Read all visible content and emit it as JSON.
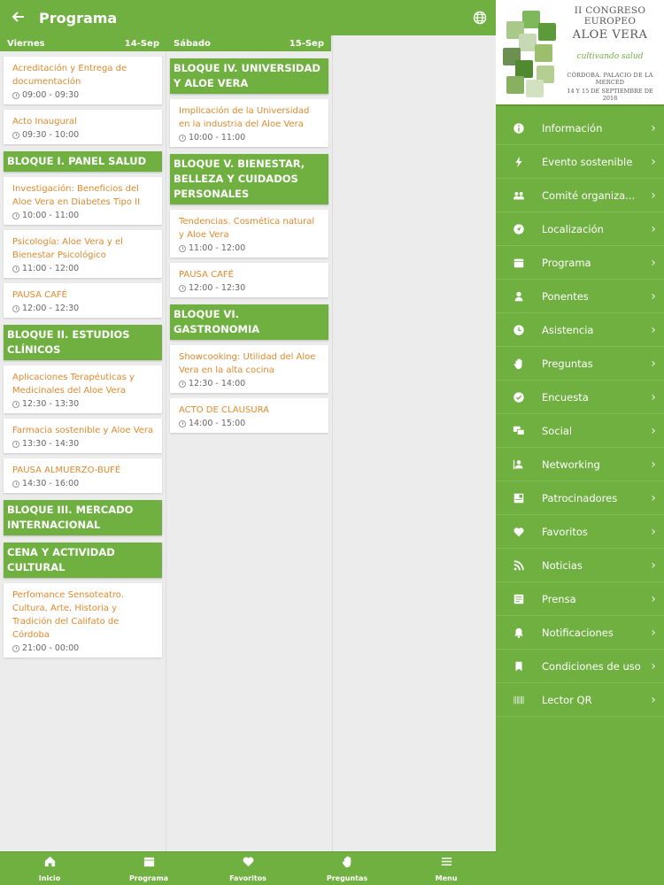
{
  "appbar": {
    "title": "Programa",
    "back_icon": "arrow-left-icon",
    "globe_icon": "globe-icon"
  },
  "days": [
    {
      "name": "Viernes",
      "date": "14-Sep",
      "items": [
        {
          "kind": "session",
          "title": "Acreditación y Entrega de documentación",
          "time": "09:00 - 09:30"
        },
        {
          "kind": "session",
          "title": "Acto Inaugural",
          "time": "09:30 - 10:00"
        },
        {
          "kind": "block",
          "title": "BLOQUE I. PANEL SALUD"
        },
        {
          "kind": "session",
          "title": "Investigación: Beneficios del Aloe Vera en Diabetes Tipo II",
          "time": "10:00 - 11:00"
        },
        {
          "kind": "session",
          "title": "Psicología: Aloe Vera y el Bienestar Psicológico",
          "time": "11:00 - 12:00"
        },
        {
          "kind": "session",
          "title": "PAUSA CAFÉ",
          "time": "12:00 - 12:30"
        },
        {
          "kind": "block",
          "title": "BLOQUE II. ESTUDIOS CLÍNICOS"
        },
        {
          "kind": "session",
          "title": "Aplicaciones Terapéuticas y Medicinales del Aloe Vera",
          "time": "12:30 - 13:30"
        },
        {
          "kind": "session",
          "title": "Farmacia sostenible y Aloe Vera",
          "time": "13:30 - 14:30"
        },
        {
          "kind": "session",
          "title": "PAUSA ALMUERZO-BUFÉ",
          "time": "14:30 - 16:00"
        },
        {
          "kind": "block",
          "title": "BLOQUE III. MERCADO INTERNACIONAL"
        },
        {
          "kind": "block",
          "title": "CENA Y ACTIVIDAD CULTURAL"
        },
        {
          "kind": "session",
          "title": "Perfomance Sensoteatro. Cultura, Arte, Historia y Tradición del Califato de Córdoba",
          "time": "21:00 - 00:00"
        }
      ]
    },
    {
      "name": "Sábado",
      "date": "15-Sep",
      "items": [
        {
          "kind": "block",
          "title": "BLOQUE IV. UNIVERSIDAD Y ALOE VERA"
        },
        {
          "kind": "session",
          "title": "Implicación de la Universidad en la industria del Aloe Vera",
          "time": "10:00 - 11:00"
        },
        {
          "kind": "block",
          "title": "BLOQUE V. BIENESTAR, BELLEZA Y CUIDADOS PERSONALES"
        },
        {
          "kind": "session",
          "title": "Tendencias. Cosmética natural y Aloe Vera",
          "time": "11:00 - 12:00"
        },
        {
          "kind": "session",
          "title": "PAUSA CAFÉ",
          "time": "12:00 - 12:30"
        },
        {
          "kind": "block",
          "title": "BLOQUE VI. GASTRONOMIA"
        },
        {
          "kind": "session",
          "title": "Showcooking: Utilidad del Aloe Vera en la alta cocina",
          "time": "12:30 - 14:00"
        },
        {
          "kind": "session",
          "title": "ACTO DE CLAUSURA",
          "time": "14:00 - 15:00"
        }
      ]
    }
  ],
  "banner": {
    "line1": "II CONGRESO EUROPEO",
    "line2": "ALOE VERA",
    "tagline": "cultivando salud",
    "place": "CÓRDOBA. PALACIO DE LA MERCED",
    "dates": "14 Y 15 DE SEPTIEMBRE DE 2018"
  },
  "menu": [
    {
      "label": "Información",
      "icon": "info-icon"
    },
    {
      "label": "Evento sostenible",
      "icon": "bolt-icon"
    },
    {
      "label": "Comité organiza...",
      "icon": "group-icon"
    },
    {
      "label": "Localización",
      "icon": "location-icon"
    },
    {
      "label": "Programa",
      "icon": "calendar-icon"
    },
    {
      "label": "Ponentes",
      "icon": "person-icon"
    },
    {
      "label": "Asistencia",
      "icon": "clock-icon"
    },
    {
      "label": "Preguntas",
      "icon": "hand-icon"
    },
    {
      "label": "Encuesta",
      "icon": "check-circle-icon"
    },
    {
      "label": "Social",
      "icon": "chat-icon"
    },
    {
      "label": "Networking",
      "icon": "contact-icon"
    },
    {
      "label": "Patrocinadores",
      "icon": "sponsors-icon"
    },
    {
      "label": "Favoritos",
      "icon": "heart-icon"
    },
    {
      "label": "Noticias",
      "icon": "rss-icon"
    },
    {
      "label": "Prensa",
      "icon": "newspaper-icon"
    },
    {
      "label": "Notificaciones",
      "icon": "bell-icon"
    },
    {
      "label": "Condiciones de uso",
      "icon": "bookmark-icon"
    },
    {
      "label": "Lector QR",
      "icon": "barcode-icon"
    }
  ],
  "tabs": [
    {
      "label": "Inicio",
      "icon": "home-icon"
    },
    {
      "label": "Programa",
      "icon": "calendar-icon"
    },
    {
      "label": "Favoritos",
      "icon": "heart-icon"
    },
    {
      "label": "Preguntas",
      "icon": "hand-icon"
    },
    {
      "label": "Menu",
      "icon": "menu-icon"
    }
  ],
  "colors": {
    "primary": "#6fb041",
    "accent_text": "#e08a2e",
    "background": "#ececec"
  }
}
